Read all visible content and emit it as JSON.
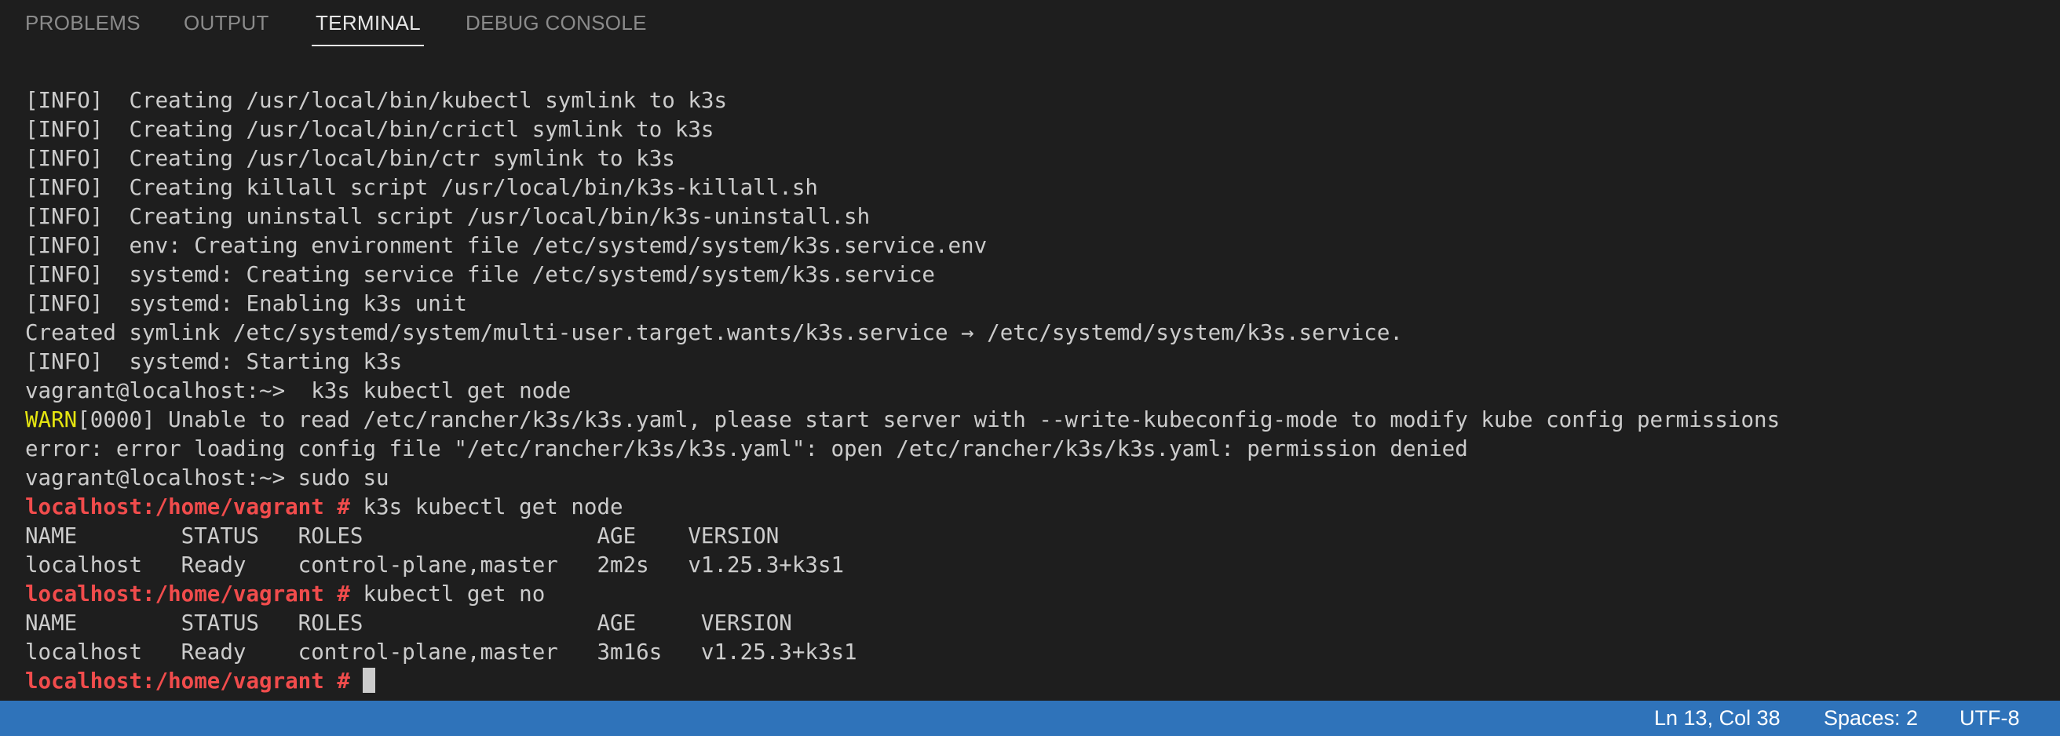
{
  "panel": {
    "tabs": [
      {
        "label": "PROBLEMS",
        "active": false
      },
      {
        "label": "OUTPUT",
        "active": false
      },
      {
        "label": "TERMINAL",
        "active": true
      },
      {
        "label": "DEBUG CONSOLE",
        "active": false
      }
    ]
  },
  "terminal": {
    "lines": [
      {
        "text": "[INFO]  Creating /usr/local/bin/kubectl symlink to k3s"
      },
      {
        "text": "[INFO]  Creating /usr/local/bin/crictl symlink to k3s"
      },
      {
        "text": "[INFO]  Creating /usr/local/bin/ctr symlink to k3s"
      },
      {
        "text": "[INFO]  Creating killall script /usr/local/bin/k3s-killall.sh"
      },
      {
        "text": "[INFO]  Creating uninstall script /usr/local/bin/k3s-uninstall.sh"
      },
      {
        "text": "[INFO]  env: Creating environment file /etc/systemd/system/k3s.service.env"
      },
      {
        "text": "[INFO]  systemd: Creating service file /etc/systemd/system/k3s.service"
      },
      {
        "text": "[INFO]  systemd: Enabling k3s unit"
      },
      {
        "text": "Created symlink /etc/systemd/system/multi-user.target.wants/k3s.service → /etc/systemd/system/k3s.service."
      },
      {
        "text": "[INFO]  systemd: Starting k3s"
      },
      {
        "text": "vagrant@localhost:~>  k3s kubectl get node"
      },
      {
        "warn": "WARN",
        "text": "[0000] Unable to read /etc/rancher/k3s/k3s.yaml, please start server with --write-kubeconfig-mode to modify kube config permissions"
      },
      {
        "text": "error: error loading config file \"/etc/rancher/k3s/k3s.yaml\": open /etc/rancher/k3s/k3s.yaml: permission denied"
      },
      {
        "text": "vagrant@localhost:~> sudo su"
      },
      {
        "prompt": "localhost:/home/vagrant #",
        "text": " k3s kubectl get node"
      },
      {
        "text": "NAME        STATUS   ROLES                  AGE    VERSION"
      },
      {
        "text": "localhost   Ready    control-plane,master   2m2s   v1.25.3+k3s1"
      },
      {
        "prompt": "localhost:/home/vagrant #",
        "text": " kubectl get no"
      },
      {
        "text": "NAME        STATUS   ROLES                  AGE     VERSION"
      },
      {
        "text": "localhost   Ready    control-plane,master   3m16s   v1.25.3+k3s1"
      },
      {
        "prompt": "localhost:/home/vagrant #",
        "text": " ",
        "cursor": true
      }
    ]
  },
  "status_bar": {
    "position": "Ln 13, Col 38",
    "indentation": "Spaces: 2",
    "encoding": "UTF-8"
  },
  "colors": {
    "background": "#1e1e1e",
    "text": "#cccccc",
    "warn": "#e5e510",
    "prompt": "#f14c4c",
    "status_bar": "#2f73ba"
  }
}
